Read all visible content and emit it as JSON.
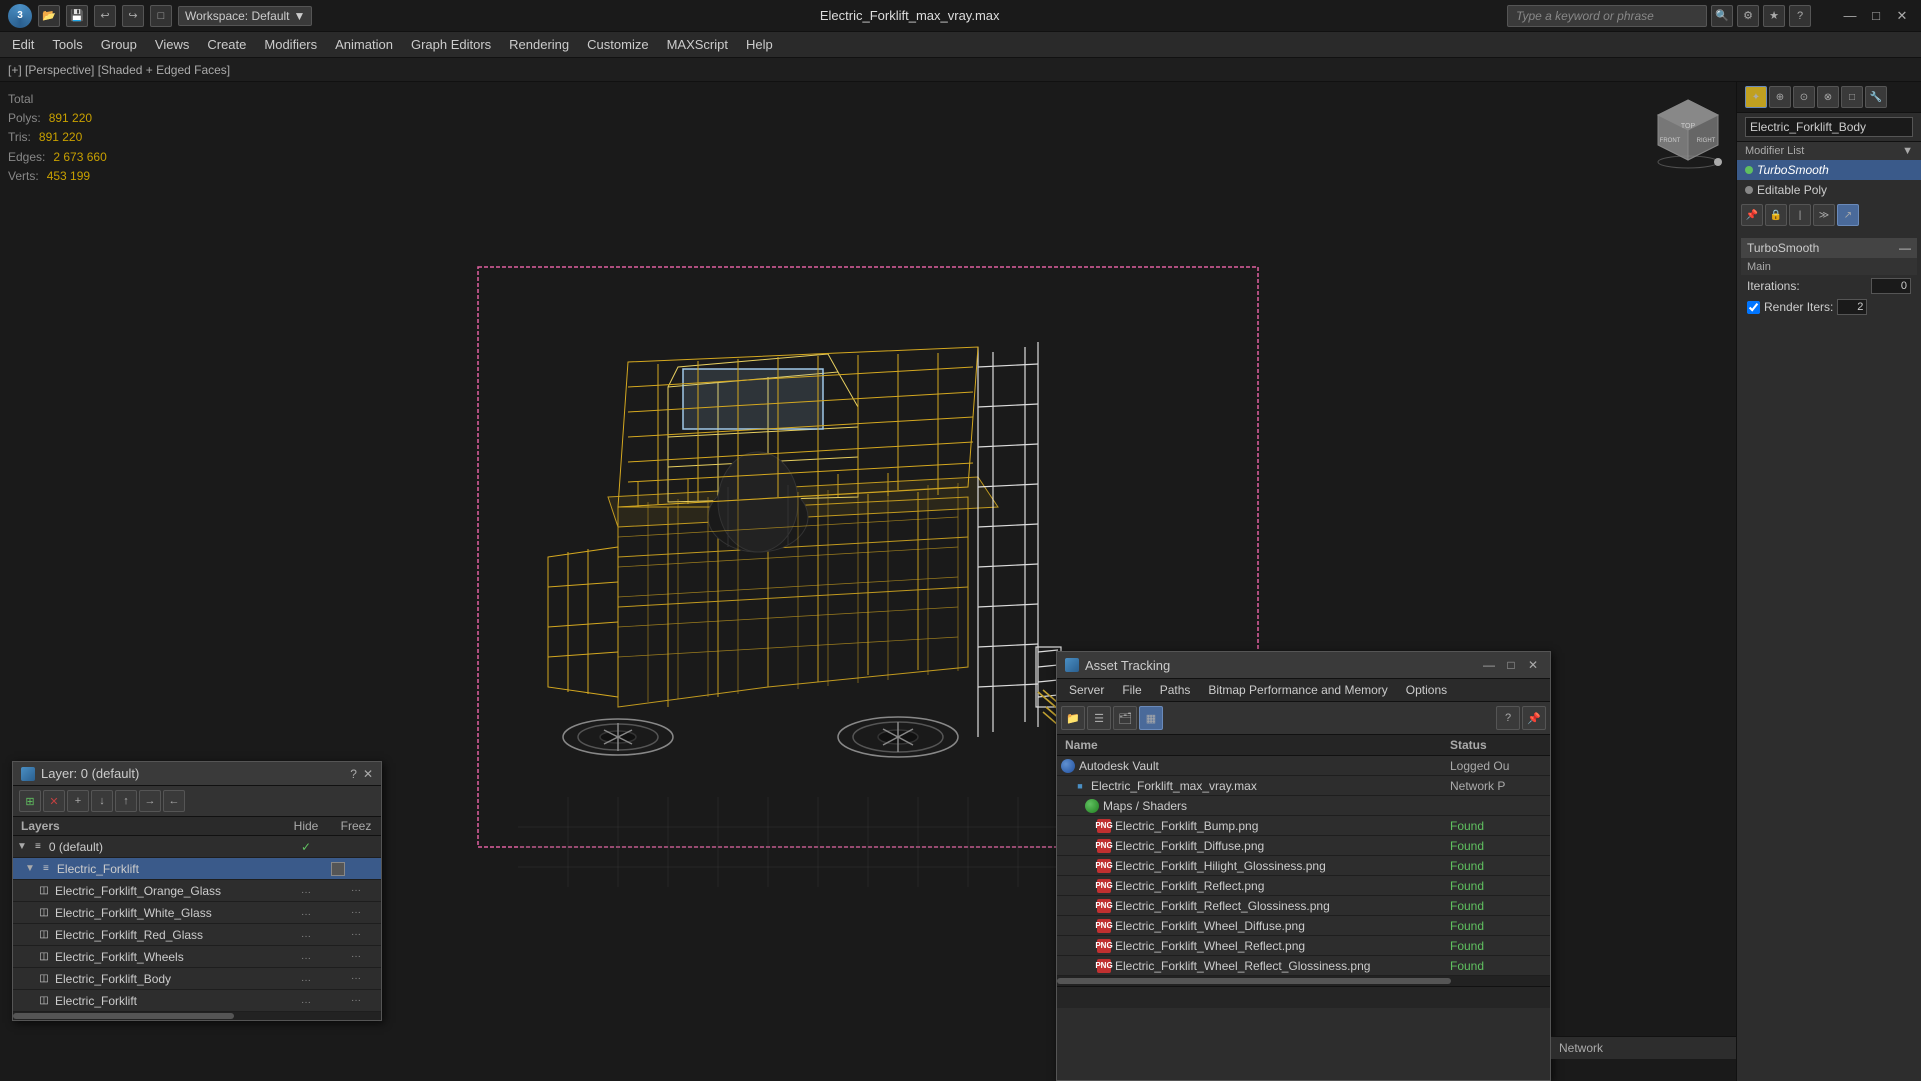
{
  "titlebar": {
    "filename": "Electric_Forklift_max_vray.max",
    "workspace": "Workspace: Default",
    "search_placeholder": "Type a keyword or phrase",
    "min_label": "—",
    "max_label": "□",
    "close_label": "✕"
  },
  "menubar": {
    "items": [
      {
        "label": "Edit"
      },
      {
        "label": "Tools"
      },
      {
        "label": "Group"
      },
      {
        "label": "Views"
      },
      {
        "label": "Create"
      },
      {
        "label": "Modifiers"
      },
      {
        "label": "Animation"
      },
      {
        "label": "Graph Editors"
      },
      {
        "label": "Rendering"
      },
      {
        "label": "Customize"
      },
      {
        "label": "MAXScript"
      },
      {
        "label": "Help"
      }
    ]
  },
  "viewport": {
    "header": "[+] [Perspective] [Shaded + Edged Faces]",
    "stats": {
      "total_label": "Total",
      "polys_label": "Polys:",
      "polys_value": "891 220",
      "tris_label": "Tris:",
      "tris_value": "891 220",
      "edges_label": "Edges:",
      "edges_value": "2 673 660",
      "verts_label": "Verts:",
      "verts_value": "453 199"
    }
  },
  "right_panel": {
    "modifier_name": "Electric_Forklift_Body",
    "modifier_list_label": "Modifier List",
    "modifiers": [
      {
        "name": "TurboSmooth",
        "selected": true,
        "italic": true
      },
      {
        "name": "Editable Poly",
        "selected": false
      }
    ],
    "turbosmooth": {
      "title": "TurboSmooth",
      "section": "Main",
      "iterations_label": "Iterations:",
      "iterations_value": "0",
      "render_iters_label": "Render Iters:",
      "render_iters_value": "2"
    }
  },
  "layers_panel": {
    "title": "Layer: 0 (default)",
    "help_label": "?",
    "close_label": "✕",
    "toolbar_buttons": [
      "⊞",
      "✕",
      "+",
      "↓",
      "↑",
      "→",
      "←"
    ],
    "columns": {
      "name": "Layers",
      "hide": "Hide",
      "freeze": "Freez"
    },
    "rows": [
      {
        "indent": 0,
        "name": "0 (default)",
        "has_check": true,
        "hide": "",
        "freeze": "",
        "selected": false,
        "expanded": true
      },
      {
        "indent": 1,
        "name": "Electric_Forklift",
        "has_check": false,
        "hide": "",
        "freeze": "",
        "selected": true,
        "expanded": true,
        "box_icon": true
      },
      {
        "indent": 2,
        "name": "Electric_Forklift_Orange_Glass",
        "has_check": false,
        "hide": "···",
        "freeze": "···",
        "selected": false
      },
      {
        "indent": 2,
        "name": "Electric_Forklift_White_Glass",
        "has_check": false,
        "hide": "···",
        "freeze": "···",
        "selected": false
      },
      {
        "indent": 2,
        "name": "Electric_Forklift_Red_Glass",
        "has_check": false,
        "hide": "···",
        "freeze": "···",
        "selected": false
      },
      {
        "indent": 2,
        "name": "Electric_Forklift_Wheels",
        "has_check": false,
        "hide": "···",
        "freeze": "···",
        "selected": false
      },
      {
        "indent": 2,
        "name": "Electric_Forklift_Body",
        "has_check": false,
        "hide": "···",
        "freeze": "···",
        "selected": false
      },
      {
        "indent": 2,
        "name": "Electric_Forklift",
        "has_check": false,
        "hide": "···",
        "freeze": "···",
        "selected": false
      }
    ]
  },
  "asset_panel": {
    "title": "Asset Tracking",
    "menu": [
      "Server",
      "File",
      "Paths",
      "Bitmap Performance and Memory",
      "Options"
    ],
    "columns": {
      "name": "Name",
      "status": "Status"
    },
    "rows": [
      {
        "indent": 0,
        "icon": "vault",
        "name": "Autodesk Vault",
        "status": "Logged Ou",
        "status_type": "logged-out"
      },
      {
        "indent": 1,
        "icon": "file",
        "name": "Electric_Forklift_max_vray.max",
        "status": "Network P",
        "status_type": "network"
      },
      {
        "indent": 2,
        "icon": "folder",
        "name": "Maps / Shaders",
        "status": "",
        "status_type": ""
      },
      {
        "indent": 3,
        "icon": "png",
        "name": "Electric_Forklift_Bump.png",
        "status": "Found",
        "status_type": "found"
      },
      {
        "indent": 3,
        "icon": "png",
        "name": "Electric_Forklift_Diffuse.png",
        "status": "Found",
        "status_type": "found"
      },
      {
        "indent": 3,
        "icon": "png",
        "name": "Electric_Forklift_Hilight_Glossiness.png",
        "status": "Found",
        "status_type": "found"
      },
      {
        "indent": 3,
        "icon": "png",
        "name": "Electric_Forklift_Reflect.png",
        "status": "Found",
        "status_type": "found"
      },
      {
        "indent": 3,
        "icon": "png",
        "name": "Electric_Forklift_Reflect_Glossiness.png",
        "status": "Found",
        "status_type": "found"
      },
      {
        "indent": 3,
        "icon": "png",
        "name": "Electric_Forklift_Wheel_Diffuse.png",
        "status": "Found",
        "status_type": "found"
      },
      {
        "indent": 3,
        "icon": "png",
        "name": "Electric_Forklift_Wheel_Reflect.png",
        "status": "Found",
        "status_type": "found"
      },
      {
        "indent": 3,
        "icon": "png",
        "name": "Electric_Forklift_Wheel_Reflect_Glossiness.png",
        "status": "Found",
        "status_type": "found"
      }
    ]
  },
  "network_label": "Network",
  "status_bar": ""
}
